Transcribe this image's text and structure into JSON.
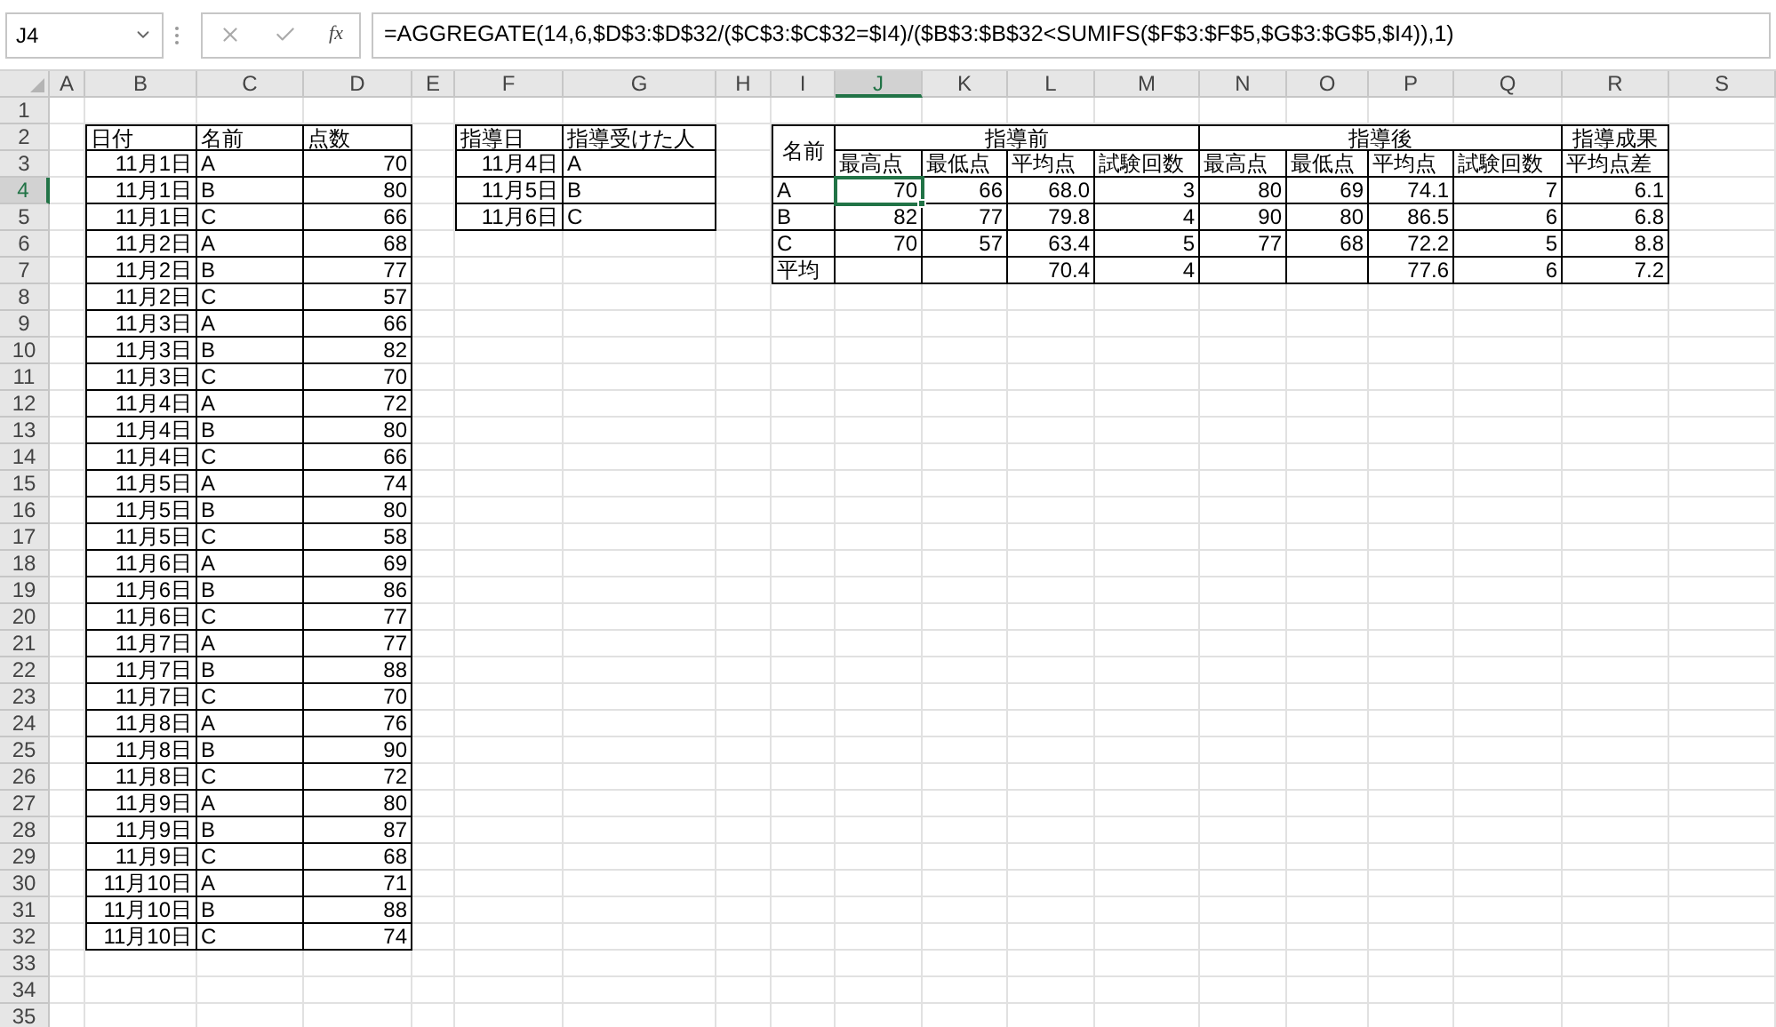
{
  "name_box": {
    "value": "J4"
  },
  "formula_bar": {
    "function_button": "fx",
    "formula": "=AGGREGATE(14,6,$D$3:$D$32/($C$3:$C$32=$I4)/($B$3:$B$32<SUMIFS($F$3:$F$5,$G$3:$G$5,$I4)),1)"
  },
  "columns": [
    {
      "label": "A",
      "selected": false
    },
    {
      "label": "B",
      "selected": false
    },
    {
      "label": "C",
      "selected": false
    },
    {
      "label": "D",
      "selected": false
    },
    {
      "label": "E",
      "selected": false
    },
    {
      "label": "F",
      "selected": false
    },
    {
      "label": "G",
      "selected": false
    },
    {
      "label": "H",
      "selected": false
    },
    {
      "label": "I",
      "selected": false
    },
    {
      "label": "J",
      "selected": true
    },
    {
      "label": "K",
      "selected": false
    },
    {
      "label": "L",
      "selected": false
    },
    {
      "label": "M",
      "selected": false
    },
    {
      "label": "N",
      "selected": false
    },
    {
      "label": "O",
      "selected": false
    },
    {
      "label": "P",
      "selected": false
    },
    {
      "label": "Q",
      "selected": false
    },
    {
      "label": "R",
      "selected": false
    },
    {
      "label": "S",
      "selected": false
    }
  ],
  "rows": [
    {
      "label": "1",
      "selected": false
    },
    {
      "label": "2",
      "selected": false
    },
    {
      "label": "3",
      "selected": false
    },
    {
      "label": "4",
      "selected": true
    },
    {
      "label": "5",
      "selected": false
    },
    {
      "label": "6",
      "selected": false
    },
    {
      "label": "7",
      "selected": false
    },
    {
      "label": "8",
      "selected": false
    },
    {
      "label": "9",
      "selected": false
    },
    {
      "label": "10",
      "selected": false
    },
    {
      "label": "11",
      "selected": false
    },
    {
      "label": "12",
      "selected": false
    },
    {
      "label": "13",
      "selected": false
    },
    {
      "label": "14",
      "selected": false
    },
    {
      "label": "15",
      "selected": false
    },
    {
      "label": "16",
      "selected": false
    },
    {
      "label": "17",
      "selected": false
    },
    {
      "label": "18",
      "selected": false
    },
    {
      "label": "19",
      "selected": false
    },
    {
      "label": "20",
      "selected": false
    },
    {
      "label": "21",
      "selected": false
    },
    {
      "label": "22",
      "selected": false
    },
    {
      "label": "23",
      "selected": false
    },
    {
      "label": "24",
      "selected": false
    },
    {
      "label": "25",
      "selected": false
    },
    {
      "label": "26",
      "selected": false
    },
    {
      "label": "27",
      "selected": false
    },
    {
      "label": "28",
      "selected": false
    },
    {
      "label": "29",
      "selected": false
    },
    {
      "label": "30",
      "selected": false
    },
    {
      "label": "31",
      "selected": false
    },
    {
      "label": "32",
      "selected": false
    },
    {
      "label": "33",
      "selected": false
    },
    {
      "label": "34",
      "selected": false
    },
    {
      "label": "35",
      "selected": false
    }
  ],
  "score_table": {
    "headers": [
      "日付",
      "名前",
      "点数"
    ],
    "rows": [
      [
        "11月1日",
        "A",
        "70"
      ],
      [
        "11月1日",
        "B",
        "80"
      ],
      [
        "11月1日",
        "C",
        "66"
      ],
      [
        "11月2日",
        "A",
        "68"
      ],
      [
        "11月2日",
        "B",
        "77"
      ],
      [
        "11月2日",
        "C",
        "57"
      ],
      [
        "11月3日",
        "A",
        "66"
      ],
      [
        "11月3日",
        "B",
        "82"
      ],
      [
        "11月3日",
        "C",
        "70"
      ],
      [
        "11月4日",
        "A",
        "72"
      ],
      [
        "11月4日",
        "B",
        "80"
      ],
      [
        "11月4日",
        "C",
        "66"
      ],
      [
        "11月5日",
        "A",
        "74"
      ],
      [
        "11月5日",
        "B",
        "80"
      ],
      [
        "11月5日",
        "C",
        "58"
      ],
      [
        "11月6日",
        "A",
        "69"
      ],
      [
        "11月6日",
        "B",
        "86"
      ],
      [
        "11月6日",
        "C",
        "77"
      ],
      [
        "11月7日",
        "A",
        "77"
      ],
      [
        "11月7日",
        "B",
        "88"
      ],
      [
        "11月7日",
        "C",
        "70"
      ],
      [
        "11月8日",
        "A",
        "76"
      ],
      [
        "11月8日",
        "B",
        "90"
      ],
      [
        "11月8日",
        "C",
        "72"
      ],
      [
        "11月9日",
        "A",
        "80"
      ],
      [
        "11月9日",
        "B",
        "87"
      ],
      [
        "11月9日",
        "C",
        "68"
      ],
      [
        "11月10日",
        "A",
        "71"
      ],
      [
        "11月10日",
        "B",
        "88"
      ],
      [
        "11月10日",
        "C",
        "74"
      ]
    ]
  },
  "guidance_table": {
    "headers": [
      "指導日",
      "指導受けた人"
    ],
    "rows": [
      [
        "11月4日",
        "A"
      ],
      [
        "11月5日",
        "B"
      ],
      [
        "11月6日",
        "C"
      ]
    ]
  },
  "summary_table": {
    "name_header": "名前",
    "groups": [
      {
        "label": "指導前",
        "subheaders": [
          "最高点",
          "最低点",
          "平均点",
          "試験回数"
        ]
      },
      {
        "label": "指導後",
        "subheaders": [
          "最高点",
          "最低点",
          "平均点",
          "試験回数"
        ]
      },
      {
        "label": "指導成果",
        "subheaders": [
          "平均点差"
        ]
      }
    ],
    "rows": [
      {
        "cells": [
          {
            "text": "A",
            "selected": false
          },
          {
            "text": "70",
            "selected": true
          },
          {
            "text": "66",
            "selected": false
          },
          {
            "text": "68.0",
            "selected": false
          },
          {
            "text": "3",
            "selected": false
          },
          {
            "text": "80",
            "selected": false
          },
          {
            "text": "69",
            "selected": false
          },
          {
            "text": "74.1",
            "selected": false
          },
          {
            "text": "7",
            "selected": false
          },
          {
            "text": "6.1",
            "selected": false
          }
        ]
      },
      {
        "cells": [
          {
            "text": "B",
            "selected": false
          },
          {
            "text": "82",
            "selected": false
          },
          {
            "text": "77",
            "selected": false
          },
          {
            "text": "79.8",
            "selected": false
          },
          {
            "text": "4",
            "selected": false
          },
          {
            "text": "90",
            "selected": false
          },
          {
            "text": "80",
            "selected": false
          },
          {
            "text": "86.5",
            "selected": false
          },
          {
            "text": "6",
            "selected": false
          },
          {
            "text": "6.8",
            "selected": false
          }
        ]
      },
      {
        "cells": [
          {
            "text": "C",
            "selected": false
          },
          {
            "text": "70",
            "selected": false
          },
          {
            "text": "57",
            "selected": false
          },
          {
            "text": "63.4",
            "selected": false
          },
          {
            "text": "5",
            "selected": false
          },
          {
            "text": "77",
            "selected": false
          },
          {
            "text": "68",
            "selected": false
          },
          {
            "text": "72.2",
            "selected": false
          },
          {
            "text": "5",
            "selected": false
          },
          {
            "text": "8.8",
            "selected": false
          }
        ]
      },
      {
        "cells": [
          {
            "text": "平均",
            "selected": false
          },
          {
            "selected": false
          },
          {
            "selected": false
          },
          {
            "text": "70.4",
            "selected": false
          },
          {
            "text": "4",
            "selected": false
          },
          {
            "selected": false
          },
          {
            "selected": false
          },
          {
            "text": "77.6",
            "selected": false
          },
          {
            "text": "6",
            "selected": false
          },
          {
            "text": "7.2",
            "selected": false
          }
        ]
      }
    ]
  }
}
